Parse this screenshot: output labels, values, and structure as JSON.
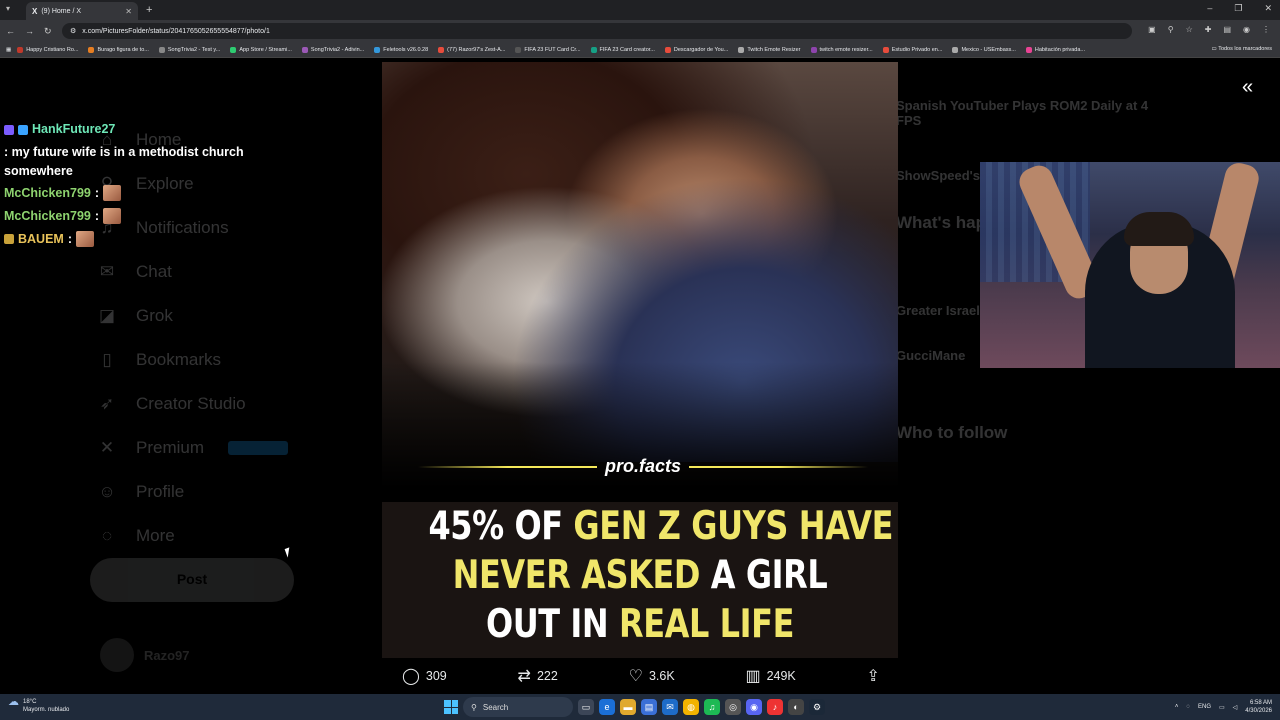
{
  "browser": {
    "tab_title": "(9) Home / X",
    "url": "x.com/PicturesFolder/status/2041765052655554877/photo/1",
    "bookmarks": [
      {
        "label": "Happy Cristiano Ro...",
        "color": "#c0392b"
      },
      {
        "label": "Burago figura de to...",
        "color": "#e67e22"
      },
      {
        "label": "SongTrivia2 - Test y...",
        "color": "#888888"
      },
      {
        "label": "App Store / Streami...",
        "color": "#2ecc71"
      },
      {
        "label": "SongTrivia2 - Adivin...",
        "color": "#9b59b6"
      },
      {
        "label": "Feletools v26.0.28",
        "color": "#3498db"
      },
      {
        "label": "(77) Razor97's Zest-A...",
        "color": "#e74c3c"
      },
      {
        "label": "FIFA 23 FUT Card Cr...",
        "color": "#555555"
      },
      {
        "label": "FIFA 23 Card creator...",
        "color": "#16a085"
      },
      {
        "label": "Descargador de You...",
        "color": "#e74c3c"
      },
      {
        "label": "Twitch Emote Resizer",
        "color": "#aaaaaa"
      },
      {
        "label": "twitch emote resizer...",
        "color": "#8e44ad"
      },
      {
        "label": "Estudio Privado en...",
        "color": "#e74c3c"
      },
      {
        "label": "Mexico - USEmbass...",
        "color": "#aaaaaa"
      },
      {
        "label": "Habitación privada...",
        "color": "#e84393"
      }
    ],
    "all_bookmarks": "Todos los marcadores"
  },
  "sidebar": {
    "items": [
      {
        "label": "Home",
        "icon": "home-icon",
        "glyph": "⌂"
      },
      {
        "label": "Explore",
        "icon": "search-icon",
        "glyph": "⚲"
      },
      {
        "label": "Notifications",
        "icon": "bell-icon",
        "glyph": "♫"
      },
      {
        "label": "Chat",
        "icon": "chat-icon",
        "glyph": "✉"
      },
      {
        "label": "Grok",
        "icon": "grok-icon",
        "glyph": "◪"
      },
      {
        "label": "Bookmarks",
        "icon": "bookmark-icon",
        "glyph": "▯"
      },
      {
        "label": "Creator Studio",
        "icon": "rocket-icon",
        "glyph": "➶"
      },
      {
        "label": "Premium",
        "icon": "x-logo-icon",
        "glyph": "✕"
      },
      {
        "label": "Profile",
        "icon": "profile-icon",
        "glyph": "☺"
      },
      {
        "label": "More",
        "icon": "more-icon",
        "glyph": "◌"
      }
    ],
    "post_label": "Post",
    "account_name": "Razo97"
  },
  "rightcol": {
    "items": [
      "Spanish YouTuber Plays ROM2 Daily at 4 FPS",
      "ShowSpeed's",
      "What's happ",
      "Greater Israel",
      "GucciMane",
      "Who to follow"
    ]
  },
  "photo": {
    "brand": "pro.facts",
    "headline_line1_a": "45% OF ",
    "headline_line1_b": "GEN Z GUYS HAVE",
    "headline_line2_a": "NEVER ASKED",
    "headline_line2_b": " A GIRL",
    "headline_line3_a": "OUT IN ",
    "headline_line3_b": "REAL LIFE",
    "highlight_color": "#f0e66a"
  },
  "actions": {
    "replies": "309",
    "reposts": "222",
    "likes": "3.6K",
    "views": "249K"
  },
  "chat": [
    {
      "user": "HankFuture27",
      "message": ": my future wife is in a methodist church somewhere",
      "color": "cyan"
    },
    {
      "user": "McChicken799",
      "message": ":",
      "color": "green"
    },
    {
      "user": "McChicken799",
      "message": ":",
      "color": "green"
    },
    {
      "user": "BAUEM",
      "message": ":",
      "color": "gold"
    }
  ],
  "taskbar": {
    "temperature": "18°C",
    "weather": "Mayorm. nublado",
    "search_label": "Search",
    "lang": "ENG",
    "time": "6:58 AM",
    "date": "4/30/2026"
  }
}
